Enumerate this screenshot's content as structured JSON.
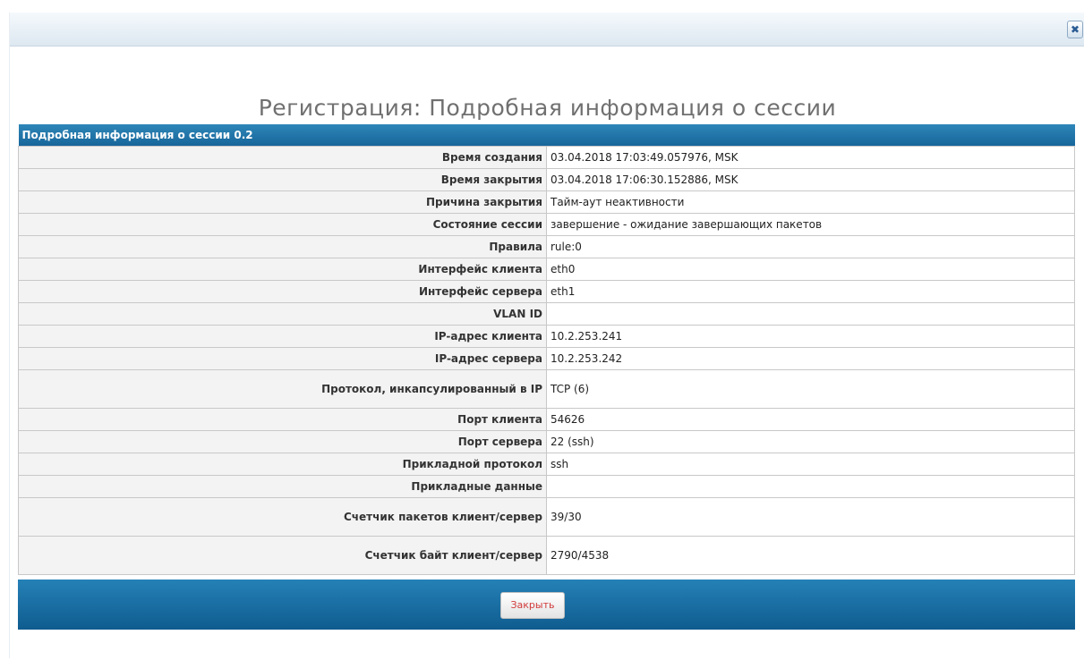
{
  "dialog": {
    "close_icon": "close-icon",
    "title": "Регистрация: Подробная информация о сессии"
  },
  "table": {
    "caption": "Подробная информация о сессии 0.2",
    "rows": [
      {
        "label": "Время создания",
        "value": "03.04.2018 17:03:49.057976, MSK"
      },
      {
        "label": "Время закрытия",
        "value": "03.04.2018 17:06:30.152886, MSK"
      },
      {
        "label": "Причина закрытия",
        "value": "Тайм-аут неактивности"
      },
      {
        "label": "Состояние сессии",
        "value": "завершение - ожидание завершающих пакетов"
      },
      {
        "label": "Правила",
        "value": "rule:0"
      },
      {
        "label": "Интерфейс клиента",
        "value": "eth0"
      },
      {
        "label": "Интерфейс сервера",
        "value": "eth1"
      },
      {
        "label": "VLAN ID",
        "value": ""
      },
      {
        "label": "IP-адрес клиента",
        "value": "10.2.253.241"
      },
      {
        "label": "IP-адрес сервера",
        "value": "10.2.253.242"
      },
      {
        "label": "Протокол, инкапсулированный в IP",
        "value": "TCP (6)"
      },
      {
        "label": "Порт клиента",
        "value": "54626"
      },
      {
        "label": "Порт сервера",
        "value": "22 (ssh)"
      },
      {
        "label": "Прикладной протокол",
        "value": "ssh"
      },
      {
        "label": "Прикладные данные",
        "value": ""
      },
      {
        "label": "Счетчик пакетов клиент/сервер",
        "value": "39/30"
      },
      {
        "label": "Счетчик байт клиент/сервер",
        "value": "2790/4538"
      }
    ]
  },
  "footer": {
    "close_label": "Закрыть"
  }
}
